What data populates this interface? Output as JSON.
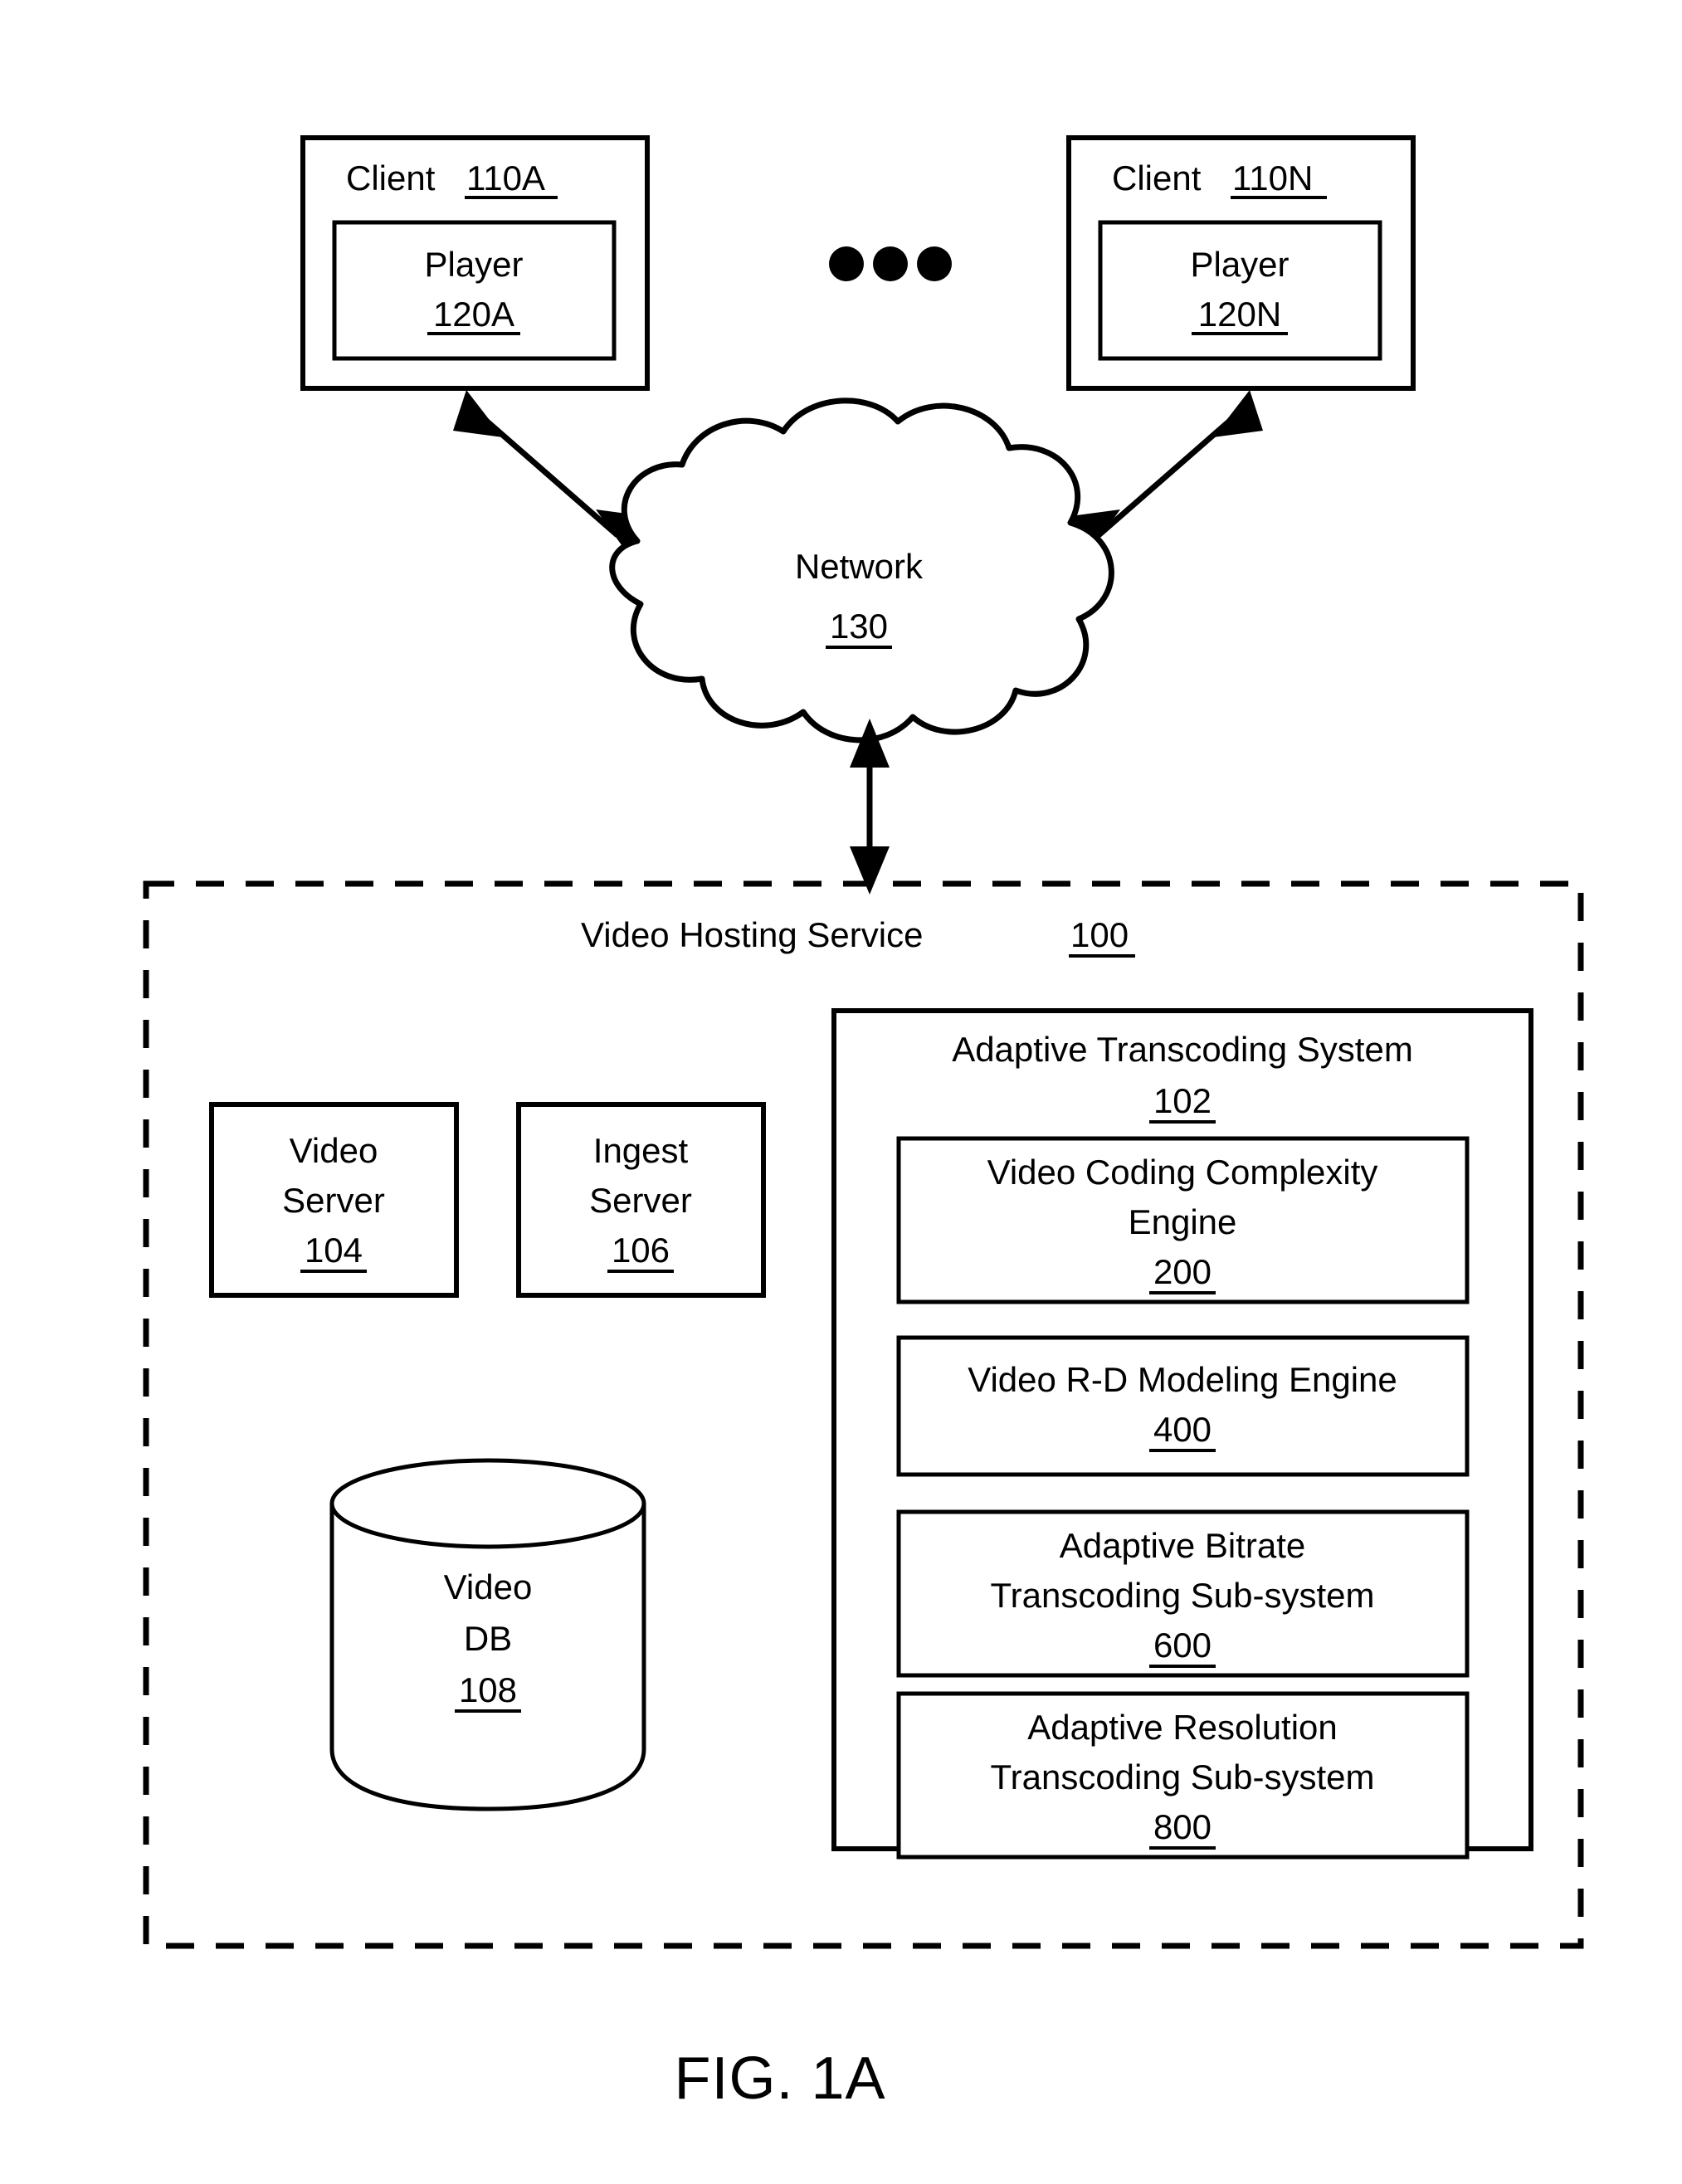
{
  "figure": {
    "caption": "FIG. 1A"
  },
  "clients": [
    {
      "label": "Client",
      "ref": "110A",
      "player": {
        "label": "Player",
        "ref": "120A"
      }
    },
    {
      "label": "Client",
      "ref": "110N",
      "player": {
        "label": "Player",
        "ref": "120N"
      }
    }
  ],
  "ellipsis": {
    "name": "more-clients-ellipsis",
    "dots": 3
  },
  "network": {
    "label": "Network",
    "ref": "130"
  },
  "service": {
    "label": "Video Hosting Service",
    "ref": "100",
    "servers": [
      {
        "line1": "Video",
        "line2": "Server",
        "ref": "104"
      },
      {
        "line1": "Ingest",
        "line2": "Server",
        "ref": "106"
      }
    ],
    "database": {
      "line1": "Video",
      "line2": "DB",
      "ref": "108"
    },
    "transcoding_system": {
      "label": "Adaptive Transcoding System",
      "ref": "102",
      "modules": [
        {
          "line1": "Video Coding Complexity",
          "line2": "Engine",
          "ref": "200"
        },
        {
          "line1": "Video R-D Modeling Engine",
          "line2": "",
          "ref": "400"
        },
        {
          "line1": "Adaptive Bitrate",
          "line2": "Transcoding Sub-system",
          "ref": "600"
        },
        {
          "line1": "Adaptive Resolution",
          "line2": "Transcoding Sub-system",
          "ref": "800"
        }
      ]
    }
  },
  "connections": [
    {
      "name": "client-a-to-network",
      "kind": "double-arrow"
    },
    {
      "name": "client-n-to-network",
      "kind": "double-arrow"
    },
    {
      "name": "network-to-service",
      "kind": "double-arrow"
    }
  ],
  "colors": {
    "ink": "#000000",
    "paper": "#ffffff"
  }
}
